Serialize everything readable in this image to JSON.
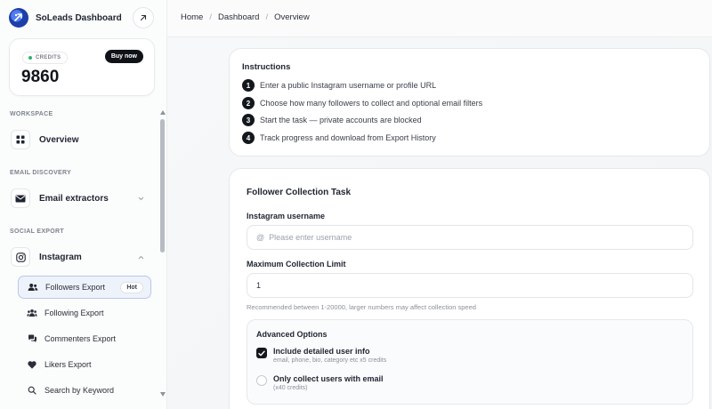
{
  "brand": {
    "name": "SoLeads Dashboard"
  },
  "credits": {
    "label": "CREDITS",
    "value": "9860",
    "buy_label": "Buy now"
  },
  "sidebar": {
    "sections": {
      "workspace": "WORKSPACE",
      "email_discovery": "EMAIL DISCOVERY",
      "social_export": "SOCIAL EXPORT"
    },
    "items": {
      "overview": "Overview",
      "email_extractors": "Email extractors",
      "instagram": "Instagram"
    },
    "sub_items": [
      {
        "label": "Followers Export",
        "badge": "Hot",
        "active": true
      },
      {
        "label": "Following Export"
      },
      {
        "label": "Commenters Export"
      },
      {
        "label": "Likers Export"
      },
      {
        "label": "Search by Keyword"
      }
    ]
  },
  "breadcrumb": [
    "Home",
    "Dashboard",
    "Overview"
  ],
  "instructions": {
    "title": "Instructions",
    "steps": [
      {
        "num": "1",
        "text": "Enter a public Instagram username or profile URL"
      },
      {
        "num": "2",
        "text": "Choose how many followers to collect and optional email filters"
      },
      {
        "num": "3",
        "text": "Start the task — private accounts are blocked"
      },
      {
        "num": "4",
        "text": "Track progress and download from Export History"
      }
    ]
  },
  "task": {
    "title": "Follower Collection Task",
    "username_label": "Instagram username",
    "username_prefix": "@",
    "username_placeholder": "Please enter username",
    "limit_label": "Maximum Collection Limit",
    "limit_value": "1",
    "limit_hint": "Recommended between 1-20000, larger numbers may affect collection speed",
    "advanced": {
      "title": "Advanced Options",
      "options": [
        {
          "label": "Include detailed user info",
          "sub": "email, phone, bio, category etc x5 credits",
          "checked": true
        },
        {
          "label": "Only collect users with email",
          "sub": "(x40 credits)",
          "checked": false
        }
      ]
    }
  }
}
